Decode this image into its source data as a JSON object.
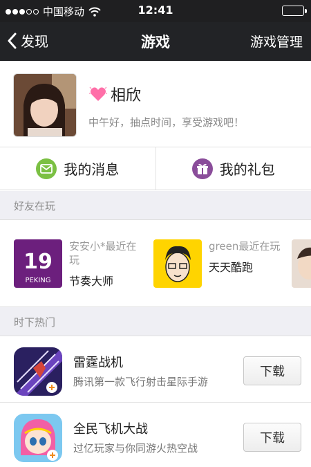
{
  "status_bar": {
    "carrier": "中国移动",
    "time": "12:41"
  },
  "nav": {
    "back_label": "发现",
    "title": "游戏",
    "right_action": "游戏管理"
  },
  "profile": {
    "name": "相欣",
    "greeting": "中午好，抽点时间，享受游戏吧！"
  },
  "actions": {
    "messages": "我的消息",
    "gifts": "我的礼包"
  },
  "sections": {
    "friends_playing": "好友在玩",
    "hot_now": "时下热门"
  },
  "friends": [
    {
      "who": "安安小*最近在玩",
      "game": "节奏大师",
      "icon_text": "19",
      "icon_sub": "PEKING"
    },
    {
      "who": "green最近在玩",
      "game": "天天酷跑"
    }
  ],
  "games": [
    {
      "name": "雷霆战机",
      "desc": "腾讯第一款飞行射击星际手游",
      "button": "下载"
    },
    {
      "name": "全民飞机大战",
      "desc": "过亿玩家与你同游火热空战",
      "button": "下载"
    }
  ],
  "colors": {
    "nav_bg": "#222326",
    "message_icon": "#7bc043",
    "gift_icon": "#8a4d9a",
    "section_bg": "#efeff4"
  }
}
